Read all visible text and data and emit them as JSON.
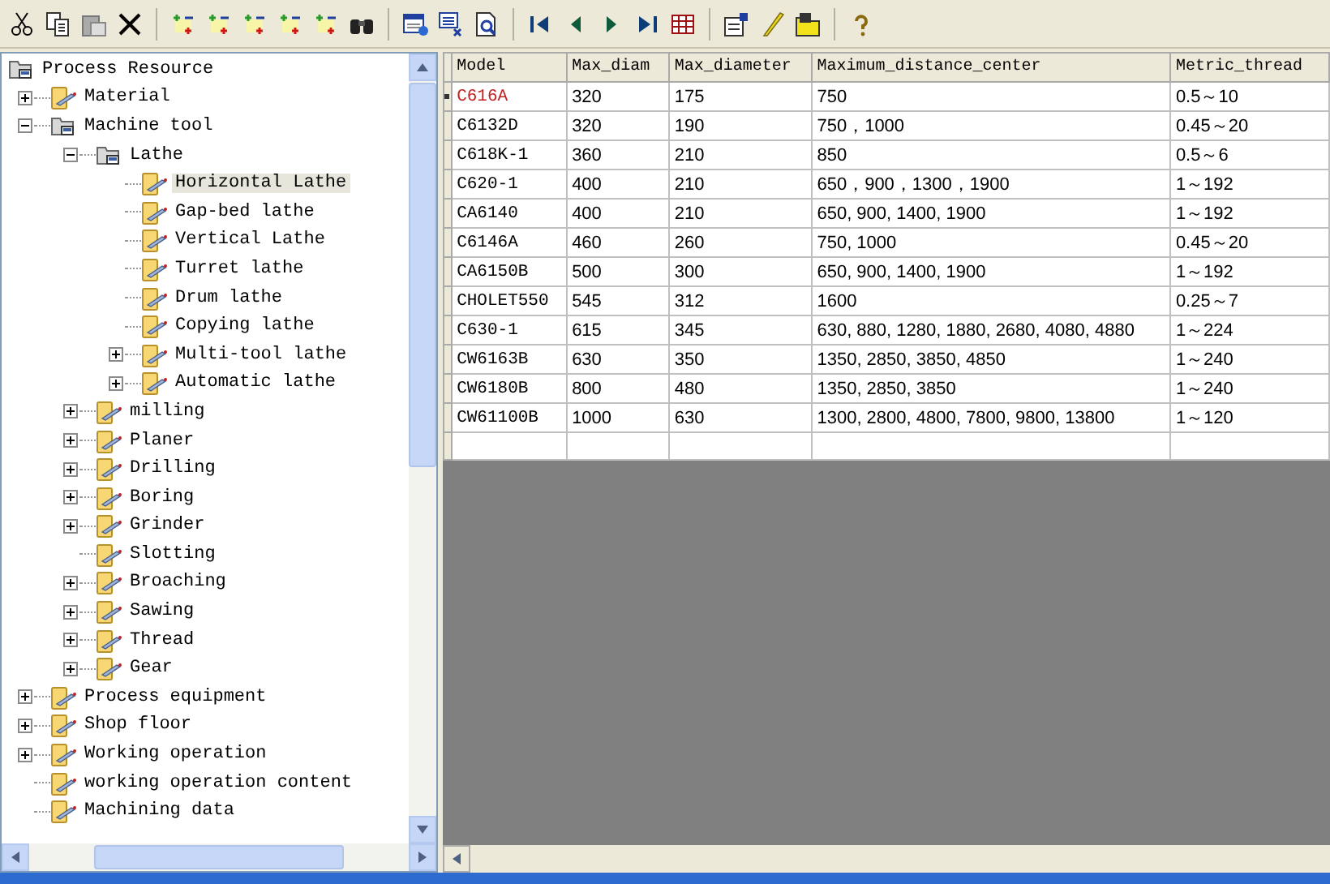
{
  "tree": {
    "label": "Process Resource",
    "kind": "group",
    "selected": false,
    "children": [
      {
        "label": "Material",
        "kind": "item",
        "selected": false,
        "expanded": false
      },
      {
        "label": "Machine tool",
        "kind": "group",
        "selected": false,
        "expanded": true,
        "children": [
          {
            "label": "Lathe",
            "kind": "group",
            "selected": false,
            "expanded": true,
            "children": [
              {
                "label": "Horizontal Lathe",
                "kind": "item",
                "selected": true
              },
              {
                "label": "Gap-bed lathe",
                "kind": "item",
                "selected": false
              },
              {
                "label": "Vertical Lathe",
                "kind": "item",
                "selected": false
              },
              {
                "label": "Turret lathe",
                "kind": "item",
                "selected": false
              },
              {
                "label": "Drum lathe",
                "kind": "item",
                "selected": false
              },
              {
                "label": "Copying lathe",
                "kind": "item",
                "selected": false
              },
              {
                "label": "Multi-tool lathe",
                "kind": "item",
                "selected": false,
                "expanded": false
              },
              {
                "label": "Automatic lathe",
                "kind": "item",
                "selected": false,
                "expanded": false
              }
            ]
          },
          {
            "label": "milling",
            "kind": "item",
            "selected": false,
            "expanded": false
          },
          {
            "label": "Planer",
            "kind": "item",
            "selected": false,
            "expanded": false
          },
          {
            "label": "Drilling",
            "kind": "item",
            "selected": false,
            "expanded": false
          },
          {
            "label": "Boring",
            "kind": "item",
            "selected": false,
            "expanded": false
          },
          {
            "label": "Grinder",
            "kind": "item",
            "selected": false,
            "expanded": false
          },
          {
            "label": "Slotting",
            "kind": "item",
            "selected": false
          },
          {
            "label": "Broaching",
            "kind": "item",
            "selected": false,
            "expanded": false
          },
          {
            "label": "Sawing",
            "kind": "item",
            "selected": false,
            "expanded": false
          },
          {
            "label": "Thread",
            "kind": "item",
            "selected": false,
            "expanded": false
          },
          {
            "label": "Gear",
            "kind": "item",
            "selected": false,
            "expanded": false
          }
        ]
      },
      {
        "label": "Process equipment",
        "kind": "item",
        "selected": false,
        "expanded": false
      },
      {
        "label": "Shop floor",
        "kind": "item",
        "selected": false,
        "expanded": false
      },
      {
        "label": "Working operation",
        "kind": "item",
        "selected": false,
        "expanded": false
      },
      {
        "label": "working operation content",
        "kind": "item",
        "selected": false
      },
      {
        "label": "Machining data",
        "kind": "item",
        "selected": false
      }
    ]
  },
  "table": {
    "columns": [
      "Model",
      "Max_diam",
      "Max_diameter",
      "Maximum_distance_center",
      "Metric_thread"
    ],
    "rows": [
      {
        "selected": true,
        "cells": [
          "C616A",
          "320",
          "175",
          "750",
          "0.5～10"
        ]
      },
      {
        "selected": false,
        "cells": [
          "C6132D",
          "320",
          "190",
          "750，1000",
          "0.45～20"
        ]
      },
      {
        "selected": false,
        "cells": [
          "C618K-1",
          "360",
          "210",
          "850",
          "0.5～6"
        ]
      },
      {
        "selected": false,
        "cells": [
          "C620-1",
          "400",
          "210",
          "650，900，1300，1900",
          "1～192"
        ]
      },
      {
        "selected": false,
        "cells": [
          "CA6140",
          "400",
          "210",
          "650, 900, 1400, 1900",
          "1～192"
        ]
      },
      {
        "selected": false,
        "cells": [
          "C6146A",
          "460",
          "260",
          "750, 1000",
          "0.45～20"
        ]
      },
      {
        "selected": false,
        "cells": [
          "CA6150B",
          "500",
          "300",
          "650, 900, 1400, 1900",
          "1～192"
        ]
      },
      {
        "selected": false,
        "cells": [
          "CHOLET550",
          "545",
          "312",
          "1600",
          "0.25～7"
        ]
      },
      {
        "selected": false,
        "cells": [
          "C630-1",
          "615",
          "345",
          "630, 880, 1280, 1880, 2680, 4080, 4880",
          "1～224"
        ]
      },
      {
        "selected": false,
        "cells": [
          "CW6163B",
          "630",
          "350",
          "1350, 2850, 3850, 4850",
          "1～240"
        ]
      },
      {
        "selected": false,
        "cells": [
          "CW6180B",
          "800",
          "480",
          "1350, 2850, 3850",
          "1～240"
        ]
      },
      {
        "selected": false,
        "cells": [
          "CW61100B",
          "1000",
          "630",
          "1300, 2800, 4800, 7800, 9800, 13800",
          "1～120"
        ]
      }
    ]
  }
}
